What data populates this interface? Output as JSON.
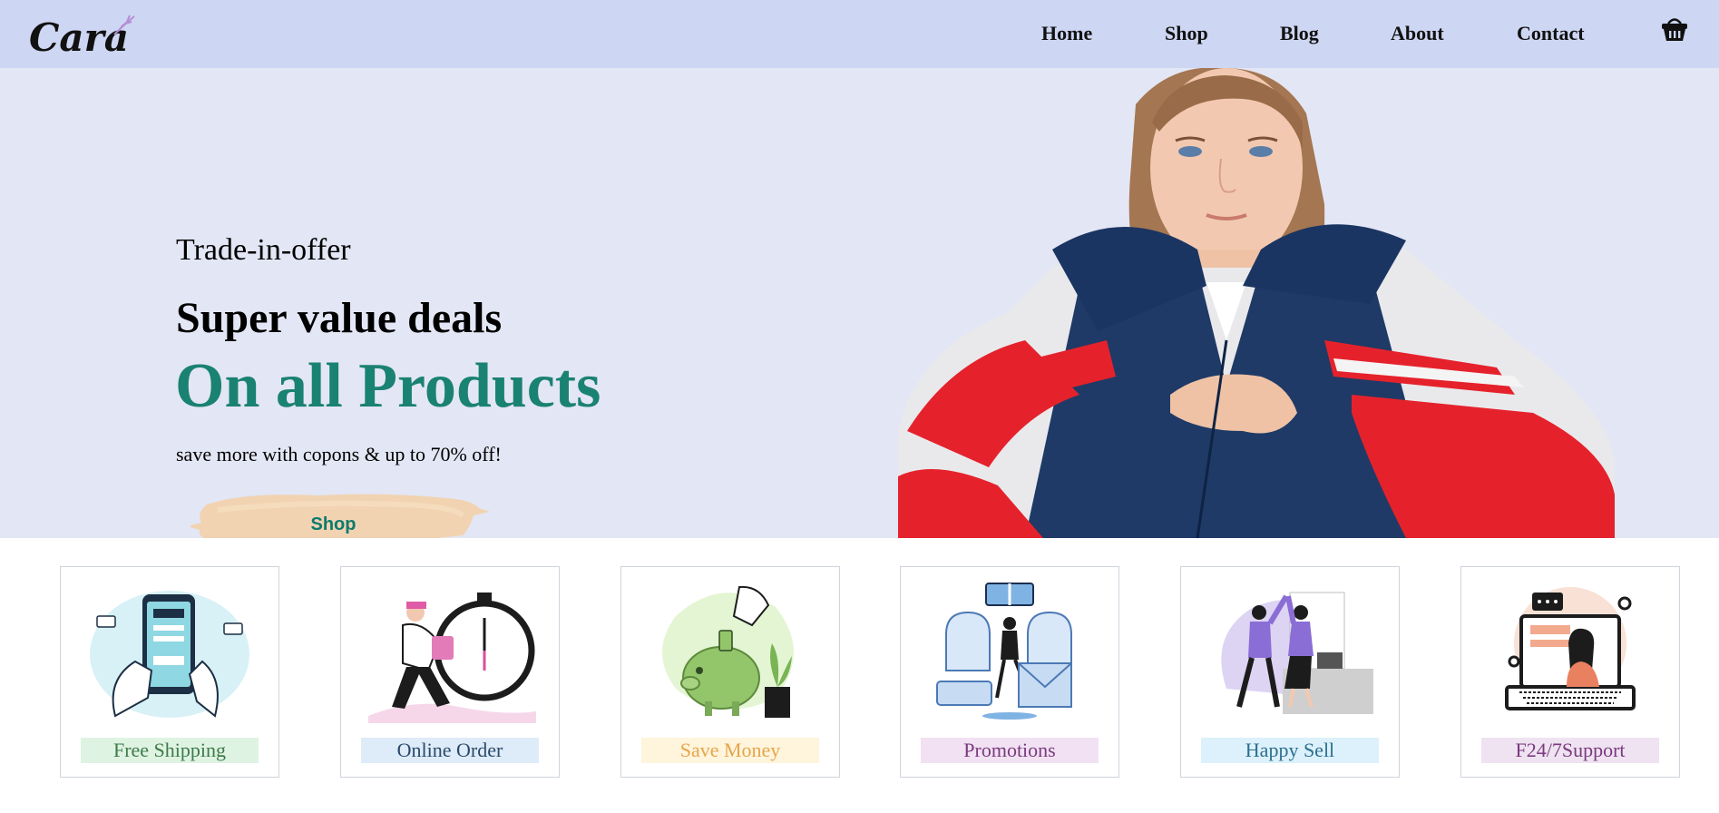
{
  "header": {
    "logo_text": "Cara",
    "nav": [
      {
        "label": "Home"
      },
      {
        "label": "Shop"
      },
      {
        "label": "Blog"
      },
      {
        "label": "About"
      },
      {
        "label": "Contact"
      }
    ],
    "cart_icon": "shopping-basket-icon"
  },
  "hero": {
    "subtitle": "Trade-in-offer",
    "heading": "Super value deals",
    "headline": "On all Products",
    "text": "save more with copons & up to 70% off!",
    "button_label": "Shop",
    "headline_color": "#1a8272"
  },
  "features": [
    {
      "label": "Free Shipping",
      "bg": "#dff3e2",
      "color": "#3d7b4a",
      "icon": "phone-payment-illustration"
    },
    {
      "label": "Online Order",
      "bg": "#deebf8",
      "color": "#2a4a6b",
      "icon": "stopwatch-runner-illustration"
    },
    {
      "label": "Save Money",
      "bg": "#fff4dc",
      "color": "#e5a64b",
      "icon": "piggy-bank-illustration"
    },
    {
      "label": "Promotions",
      "bg": "#f1e1f3",
      "color": "#7a3a7e",
      "icon": "gift-promotion-illustration"
    },
    {
      "label": "Happy Sell",
      "bg": "#dcf1fb",
      "color": "#2c6f8f",
      "icon": "high-five-illustration"
    },
    {
      "label": "F24/7Support",
      "bg": "#efe2f1",
      "color": "#7a3a7e",
      "icon": "laptop-support-illustration"
    }
  ],
  "colors": {
    "header_bg": "#cdd6f2",
    "hero_bg": "#e3e6f4",
    "accent": "#1a8272"
  }
}
